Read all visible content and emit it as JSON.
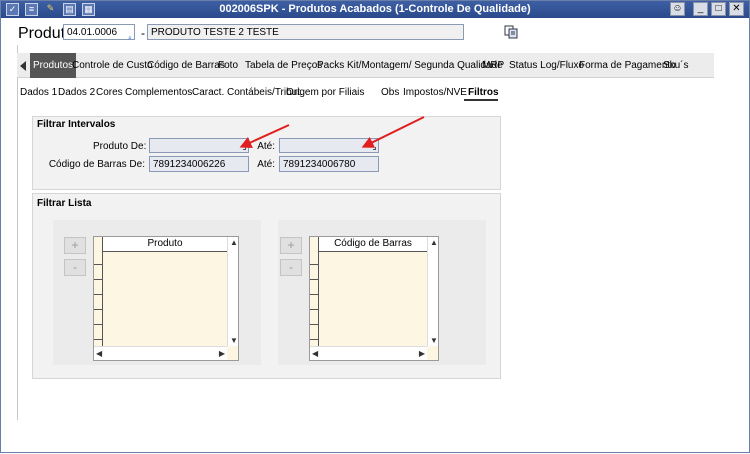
{
  "window": {
    "title": "002006SPK - Produtos Acabados (1-Controle De Qualidade)",
    "icons": [
      "checkbox-icon",
      "traffic-light-icon",
      "wrench-icon",
      "document-icon",
      "table-icon"
    ]
  },
  "header": {
    "label": "Produto",
    "code_value": "04.01.0006",
    "separator": "-",
    "name_value": "PRODUTO TESTE 2 TESTE",
    "copy_icon": "copy-icon"
  },
  "tabs": [
    {
      "label": "Produtos",
      "active": true
    },
    {
      "label": "Controle de Custo"
    },
    {
      "label": "Código de Barras"
    },
    {
      "label": "Foto"
    },
    {
      "label": "Tabela de Preços"
    },
    {
      "label": "Packs"
    },
    {
      "label": "Kit/Montagem/ Segunda Qualidade"
    },
    {
      "label": "MRP"
    },
    {
      "label": "Status Log/Fluxo"
    },
    {
      "label": "Forma de Pagamento"
    },
    {
      "label": "Sku´s"
    }
  ],
  "subtabs": [
    {
      "label": "Dados 1"
    },
    {
      "label": "Dados 2"
    },
    {
      "label": "Cores"
    },
    {
      "label": "Complementos"
    },
    {
      "label": "Caract. Contábeis/Tribut."
    },
    {
      "label": "Origem por Filiais"
    },
    {
      "label": "Obs"
    },
    {
      "label": "Impostos/NVE"
    },
    {
      "label": "Filtros",
      "active": true
    }
  ],
  "filtrar_intervalos": {
    "title": "Filtrar Intervalos",
    "produto_de_label": "Produto De:",
    "produto_de_value": "",
    "produto_ate_label": "Até:",
    "produto_ate_value": "",
    "barras_de_label": "Código de Barras De:",
    "barras_de_value": "7891234006226",
    "barras_ate_label": "Até:",
    "barras_ate_value": "7891234006780"
  },
  "filtrar_lista": {
    "title": "Filtrar Lista",
    "add_label": "+",
    "remove_label": "-",
    "produto_header": "Produto",
    "barras_header": "Código de Barras"
  },
  "colors": {
    "titlebar": "#2f4f92",
    "list_bg": "#fdf6e2",
    "active_tab": "#555555",
    "annotation_arrow": "#e02020"
  }
}
